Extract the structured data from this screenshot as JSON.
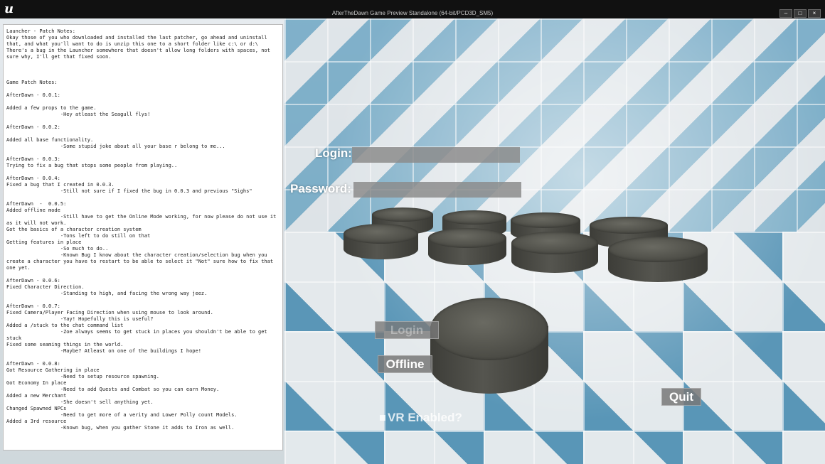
{
  "window": {
    "logo": "u",
    "title": "AfterTheDawn Game Preview Standalone (64-bit/PCD3D_SM5)",
    "minimize": "–",
    "restore": "□",
    "close": "×"
  },
  "notes": {
    "text": "Launcher - Patch Notes:\nOkay those of you who downloaded and installed the last patcher, go ahead and uninstall\nthat, and what you'll want to do is unzip this one to a short folder like c:\\ or d:\\\nThere's a bug in the Launcher somewhere that doesn't allow long folders with spaces, not\nsure why, I'll get that fixed soon.\n\n\n\nGame Patch Notes:\n\nAfterDawn - 0.0.1:\n\nAdded a few props to the game.\n                  -Hey atleast the Seagull flys!\n\nAfterDawn - 0.0.2:\n\nAdded all base functionality.\n                  -Some stupid joke about all your base r belong to me...\n\nAfterDawn - 0.0.3:\nTrying to fix a bug that stops some people from playing..\n\nAfterDawn - 0.0.4:\nFixed a bug that I created in 0.0.3.\n                  -Still not sure if I fixed the bug in 0.0.3 and previous \"Sighs\"\n\nAfterDawn  -  0.0.5:\nAdded offline mode\n                  -Still have to get the Online Mode working, for now please do not use it\nas it will not work.\nGot the basics of a character creation system\n                  -Tons left to do still on that\nGetting features in place\n                  -So much to do..\n                  -Known Bug I know about the character creation/selection bug when you\ncreate a character you have to restart to be able to select it \"Not\" sure how to fix that\none yet.\n\nAfterDawn - 0.0.6:\nFixed Character Direction.\n                  -Standing to high, and facing the wrong way jeez.\n\nAfterDawn - 0.0.7:\nFixed Camera/Player Facing Direction when using mouse to look around.\n                  -Yay! Hopefully this is useful?\nAdded a /stuck to the chat command list\n                  -Zoe always seems to get stuck in places you shouldn't be able to get\nstuck\nFixed some seaming things in the world.\n                  -Maybe? Atleast on one of the buildings I hope!\n\nAfterDawn - 0.0.8:\nGot Resource Gathering in place\n                  -Need to setup resource spawning.\nGot Economy In place\n                  -Need to add Quests and Combat so you can earn Money.\nAdded a new Merchant\n                  -She doesn't sell anything yet.\nChanged Spawned NPCs\n                  -Need to get more of a verity and Lower Polly count Models.\nAdded a 3rd resource\n                  -Known bug, when you gather Stone it adds to Iron as well."
  },
  "login": {
    "login_label": "Login:",
    "login_value": "",
    "password_label": "Password:",
    "password_value": "",
    "login_button": "Login",
    "offline_button": "Offline",
    "quit_button": "Quit",
    "vr_label": "VR Enabled?"
  }
}
